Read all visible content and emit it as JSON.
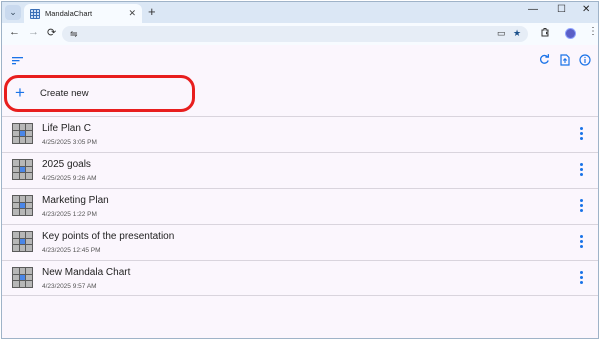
{
  "browser": {
    "tab_dropdown_icon": "chevron-down-icon",
    "tab_title": "MandalaChart",
    "tab_close": "✕",
    "new_tab": "+",
    "minimize": "—",
    "maximize": "☐",
    "close": "✕",
    "back": "←",
    "forward": "→",
    "reload": "⟳",
    "site_info": "⇋",
    "menu": "⋮",
    "bookmark": "★",
    "cast": "▭"
  },
  "app": {
    "sort_icon": "sort-icon",
    "refresh_icon": "refresh-icon",
    "export_icon": "export-icon",
    "info_icon": "info-icon",
    "create_plus": "+",
    "create_label": "Create new",
    "accent": "#1a73e8",
    "highlight_color": "#e81e1e"
  },
  "charts": [
    {
      "name": "Life Plan C",
      "date": "4/25/2025 3:05 PM"
    },
    {
      "name": "2025 goals",
      "date": "4/25/2025 9:26 AM"
    },
    {
      "name": "Marketing Plan",
      "date": "4/23/2025 1:22 PM"
    },
    {
      "name": "Key points of the presentation",
      "date": "4/23/2025 12:45 PM"
    },
    {
      "name": "New Mandala Chart",
      "date": "4/23/2025 9:57 AM"
    }
  ]
}
